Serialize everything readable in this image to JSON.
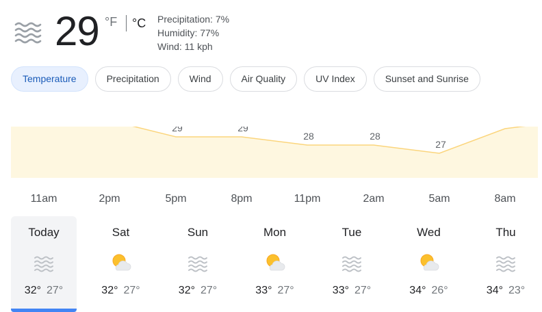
{
  "current": {
    "temp": "29",
    "unit_f": "°F",
    "unit_c": "°C",
    "icon": "haze-icon",
    "precipitation": "Precipitation: 7%",
    "humidity": "Humidity: 77%",
    "wind": "Wind: 11 kph"
  },
  "tabs": [
    {
      "label": "Temperature",
      "active": true
    },
    {
      "label": "Precipitation"
    },
    {
      "label": "Wind"
    },
    {
      "label": "Air Quality"
    },
    {
      "label": "UV Index"
    },
    {
      "label": "Sunset and Sunrise"
    }
  ],
  "colors": {
    "accent": "#4285f4",
    "chart_fill": "#fef7e0",
    "chart_line": "#fbd57c",
    "tab_active_bg": "#e8f0fe",
    "tab_active_text": "#1a5bb8"
  },
  "chart_data": {
    "type": "area",
    "x": [
      "11am",
      "2pm",
      "5pm",
      "8pm",
      "11pm",
      "2am",
      "5am",
      "8am"
    ],
    "values": [
      32,
      31,
      29,
      29,
      28,
      28,
      27,
      30
    ]
  },
  "days": [
    {
      "name": "Today",
      "icon": "haze-icon",
      "hi": "32°",
      "lo": "27°",
      "selected": true
    },
    {
      "name": "Sat",
      "icon": "partly-cloudy-icon",
      "hi": "32°",
      "lo": "27°"
    },
    {
      "name": "Sun",
      "icon": "haze-icon",
      "hi": "32°",
      "lo": "27°"
    },
    {
      "name": "Mon",
      "icon": "partly-cloudy-icon",
      "hi": "33°",
      "lo": "27°"
    },
    {
      "name": "Tue",
      "icon": "haze-icon",
      "hi": "33°",
      "lo": "27°"
    },
    {
      "name": "Wed",
      "icon": "partly-cloudy-icon",
      "hi": "34°",
      "lo": "26°"
    },
    {
      "name": "Thu",
      "icon": "haze-icon",
      "hi": "34°",
      "lo": "23°"
    }
  ]
}
